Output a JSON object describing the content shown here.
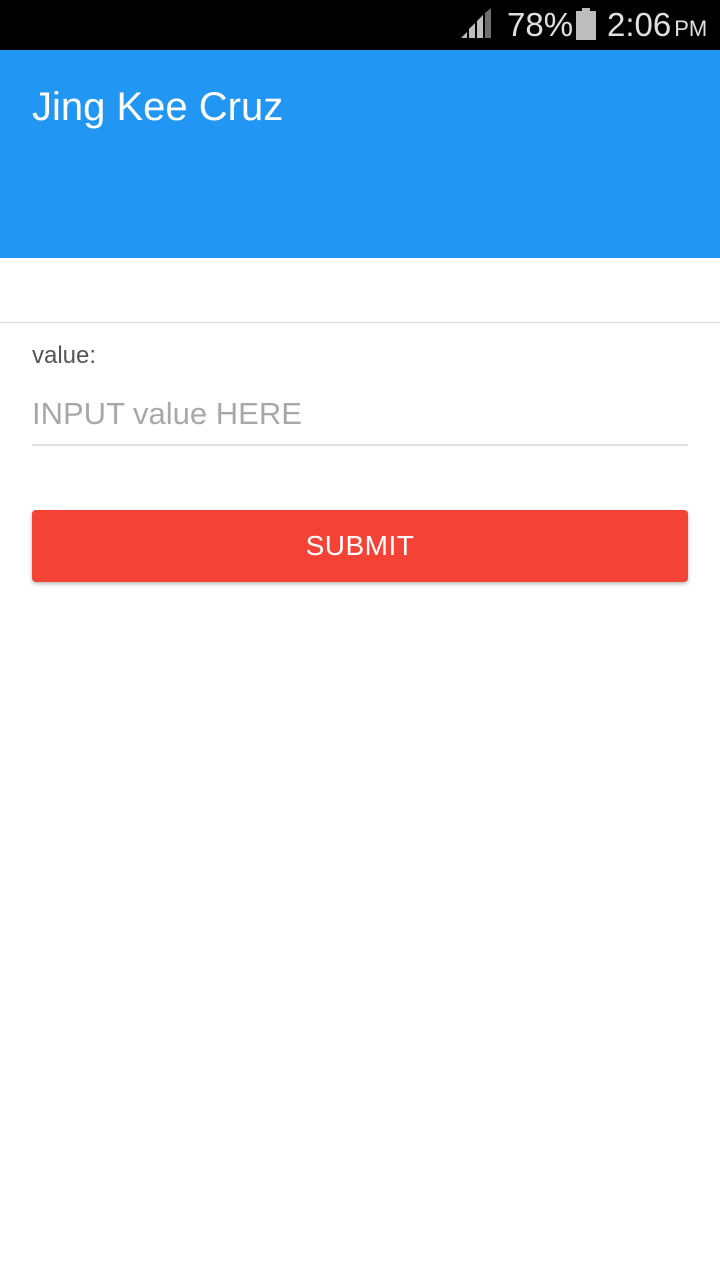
{
  "status_bar": {
    "battery_percent": "78%",
    "time": "2:06",
    "ampm": "PM",
    "icons": [
      "signal-icon",
      "battery-icon"
    ]
  },
  "app_bar": {
    "title": "Jing Kee Cruz",
    "color": "#2196f3"
  },
  "form": {
    "field_label": "value:",
    "input_value": "",
    "input_placeholder": "INPUT value HERE",
    "submit_label": "SUBMIT",
    "submit_color": "#f44336"
  }
}
